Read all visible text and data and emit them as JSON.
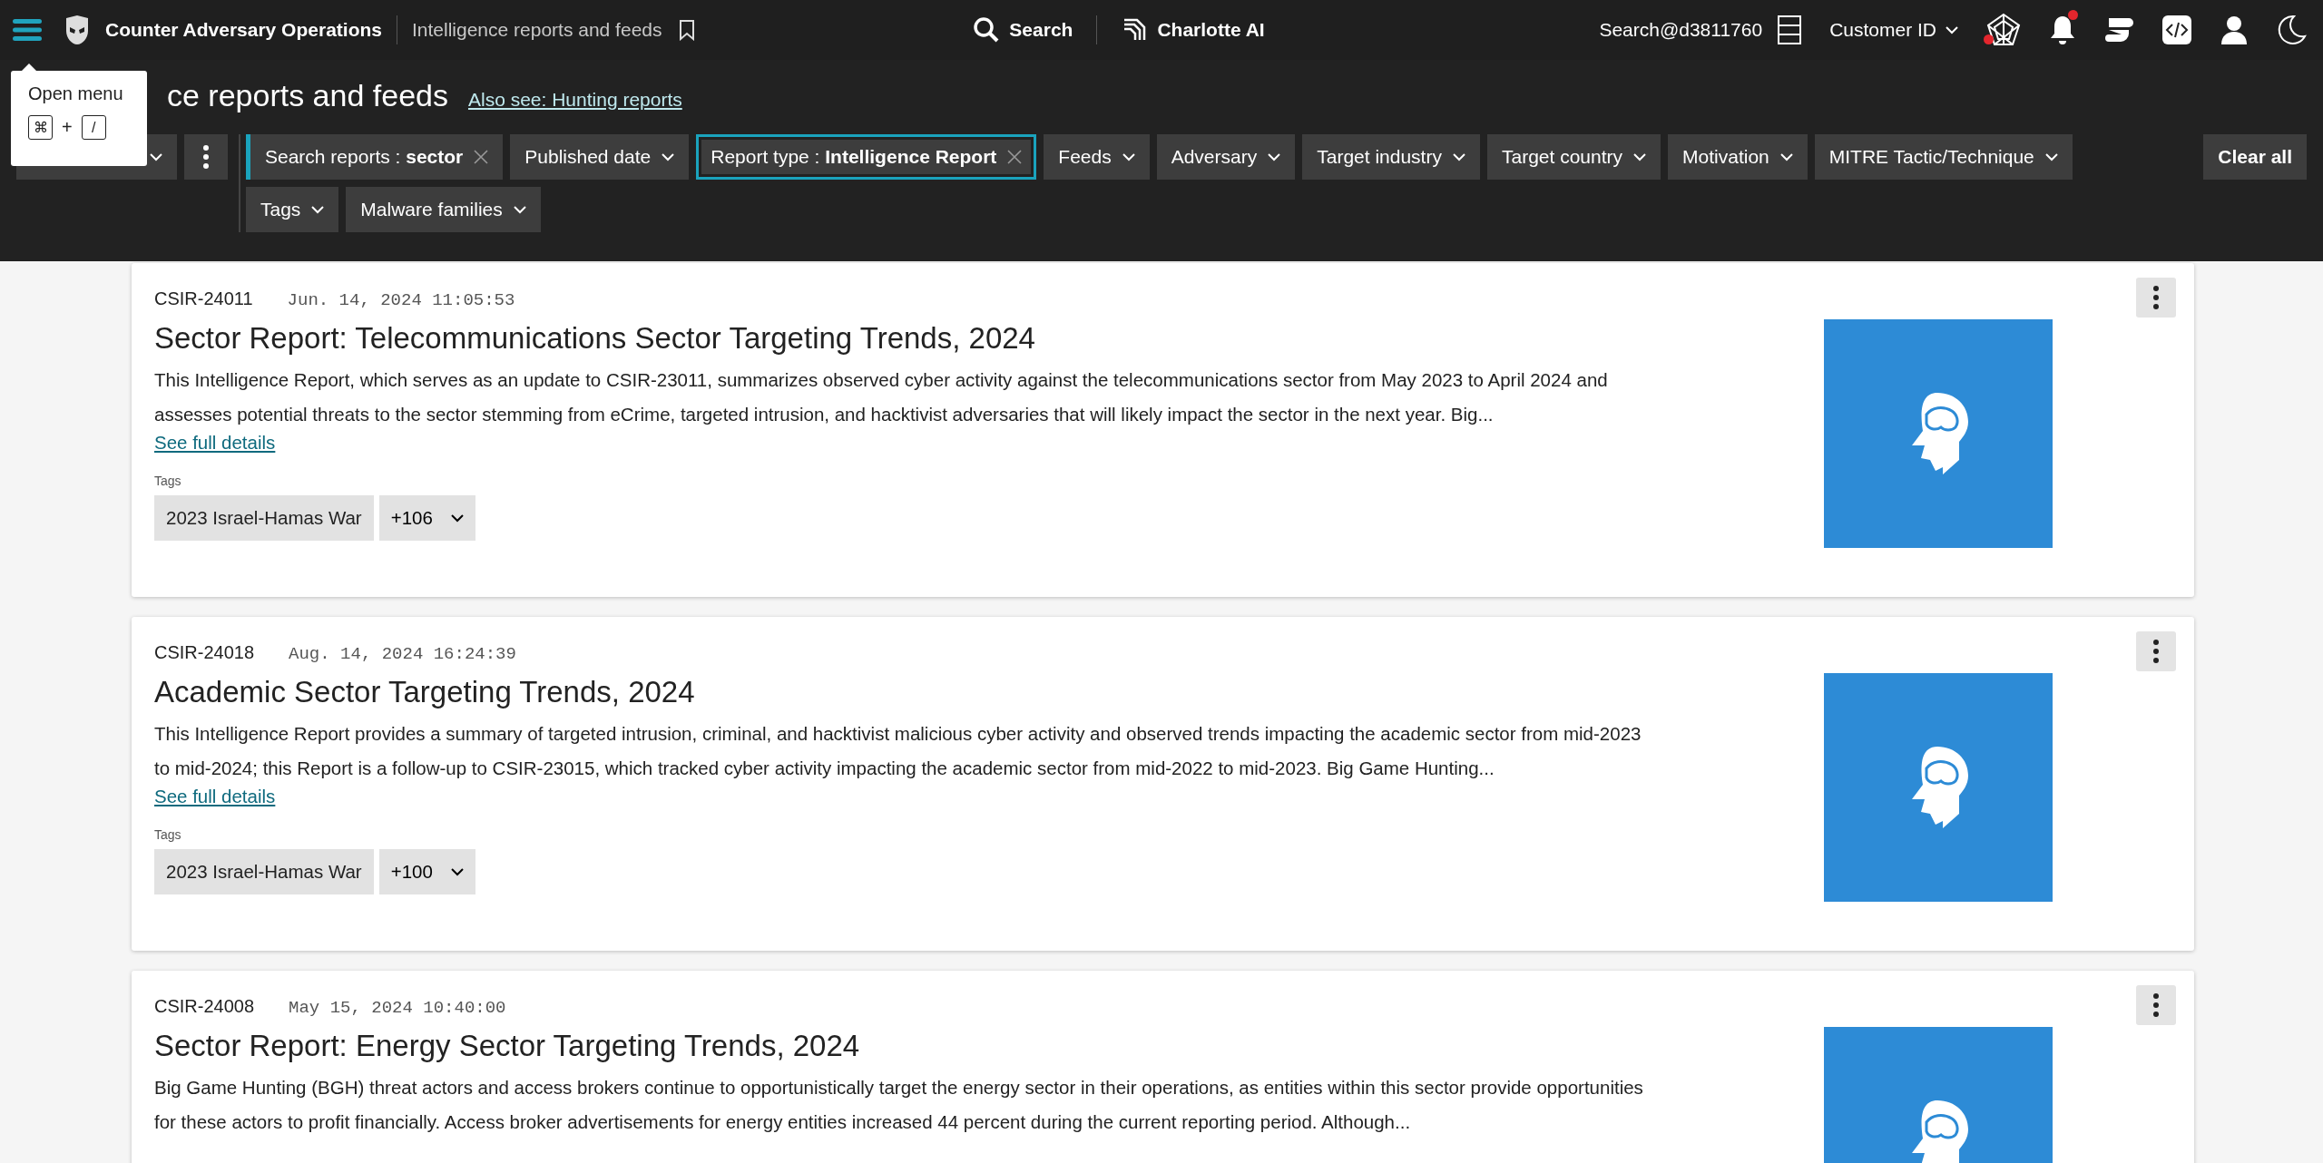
{
  "header": {
    "app_name": "Counter Adversary Operations",
    "breadcrumb": "Intelligence reports and feeds",
    "search": "Search",
    "assistant": "Charlotte AI",
    "user": "Search@d3811760",
    "customer": "Customer ID",
    "icons": [
      {
        "kind": "spider",
        "dot": true
      },
      {
        "kind": "bell",
        "dot": true
      },
      {
        "kind": "logo",
        "dot": false
      },
      {
        "kind": "code",
        "dot": false
      },
      {
        "kind": "user",
        "dot": false
      },
      {
        "kind": "moon",
        "dot": false
      }
    ]
  },
  "tooltip": {
    "title": "Open menu",
    "keys": [
      "⌘",
      "/"
    ],
    "joiner": "+"
  },
  "page": {
    "title": "ce reports and feeds",
    "link": "Also see: Hunting reports"
  },
  "filter_rows": [
    [
      {
        "kind": "value",
        "label": "Search reports :",
        "value": "sector",
        "selected": false
      },
      {
        "kind": "dropdown",
        "label": "Published date",
        "selected": false
      },
      {
        "kind": "value",
        "label": "Report type :",
        "value": "Intelligence Report",
        "selected": true
      },
      {
        "kind": "dropdown",
        "label": "Feeds",
        "selected": false
      },
      {
        "kind": "dropdown",
        "label": "Adversary",
        "selected": false
      },
      {
        "kind": "dropdown",
        "label": "Target industry",
        "selected": false
      },
      {
        "kind": "dropdown",
        "label": "Target country",
        "selected": false
      },
      {
        "kind": "dropdown",
        "label": "Motivation",
        "selected": false
      },
      {
        "kind": "dropdown",
        "label": "MITRE Tactic/Technique",
        "selected": false
      }
    ],
    [
      {
        "kind": "dropdown",
        "label": "Tags",
        "selected": false
      },
      {
        "kind": "dropdown",
        "label": "Malware families",
        "selected": false
      }
    ]
  ],
  "clear_all": "Clear all",
  "reports": [
    {
      "id": "CSIR-24011",
      "date": "Jun. 14, 2024 11:05:53",
      "title": "Sector Report: Telecommunications Sector Targeting Trends, 2024",
      "summary": "This Intelligence Report, which serves as an update to CSIR-23011, summarizes observed cyber activity against the telecommunications sector from May 2023 to April 2024 and assesses potential threats to the sector stemming from eCrime, targeted intrusion, and hacktivist adversaries that will likely impact the sector in the next year. Big...",
      "link": "See full details",
      "tags_label": "Tags",
      "tags": [
        "2023 Israel-Hamas War"
      ],
      "more": "+106"
    },
    {
      "id": "CSIR-24018",
      "date": "Aug. 14, 2024 16:24:39",
      "title": "Academic Sector Targeting Trends, 2024",
      "summary": "This Intelligence Report provides a summary of targeted intrusion, criminal, and hacktivist malicious cyber activity and observed trends impacting the academic sector from mid-2023 to mid-2024; this Report is a follow-up to CSIR-23015, which tracked cyber activity impacting the academic sector from mid-2022 to mid-2023. Big Game Hunting...",
      "link": "See full details",
      "tags_label": "Tags",
      "tags": [
        "2023 Israel-Hamas War"
      ],
      "more": "+100"
    },
    {
      "id": "CSIR-24008",
      "date": "May 15, 2024 10:40:00",
      "title": "Sector Report: Energy Sector Targeting Trends, 2024",
      "summary": "Big Game Hunting (BGH) threat actors and access brokers continue to opportunistically target the energy sector in their operations, as entities within this sector provide opportunities for these actors to profit financially. Access broker advertisements for energy entities increased 44 percent during the current reporting period. Although..."
    }
  ]
}
